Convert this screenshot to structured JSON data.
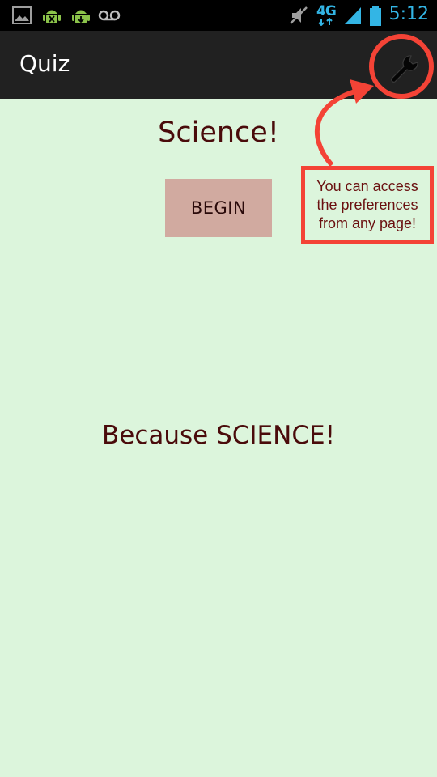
{
  "status_bar": {
    "icons": [
      "image-icon",
      "android-debug-icon",
      "android-update-icon",
      "voicemail-icon",
      "mute-icon",
      "network-4g-lte-icon",
      "signal-icon",
      "battery-icon"
    ],
    "network_label": "4G",
    "time": "5:12",
    "accent_color": "#33b5e5"
  },
  "action_bar": {
    "title": "Quiz",
    "settings_icon": "wrench-icon"
  },
  "main": {
    "heading": "Science!",
    "begin_label": "BEGIN",
    "tagline": "Because SCIENCE!"
  },
  "annotation": {
    "callout_text": "You can access the preferences from any page!",
    "color": "#f44336"
  },
  "colors": {
    "background": "#dcf5dc",
    "text": "#4a0b0b",
    "button": "#d1aaa0",
    "action_bar": "#212121"
  }
}
